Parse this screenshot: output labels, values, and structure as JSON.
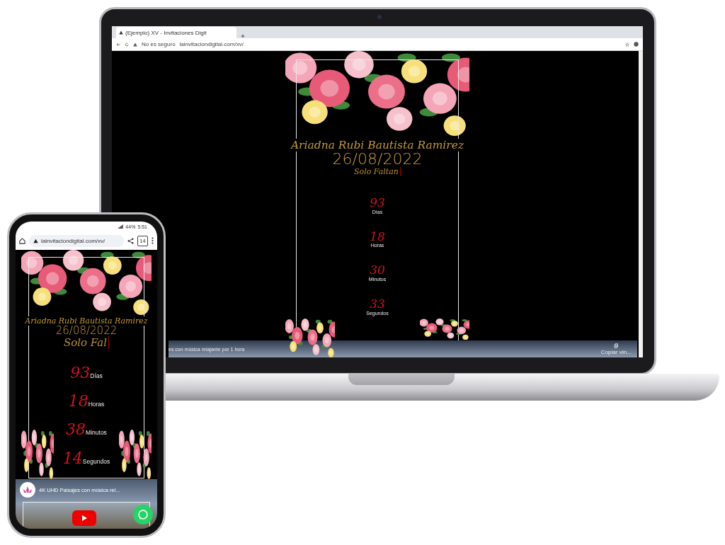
{
  "laptop": {
    "browser": {
      "tab_title": "(Ejemplo) XV - Invitaciones Digit",
      "security": "No es seguro",
      "url": "lainvitaciondigital.com/xv/"
    },
    "invitation": {
      "name": "Ariadna Rubi Bautista Ramirez",
      "date": "26/08/2022",
      "subtitle": "Solo Faltan",
      "countdown": [
        {
          "value": "93",
          "unit": "Días"
        },
        {
          "value": "18",
          "unit": "Horas"
        },
        {
          "value": "30",
          "unit": "Minutos"
        },
        {
          "value": "33",
          "unit": "Segundos"
        }
      ]
    },
    "video_bar": {
      "title": "es con música relajante por 1 hora",
      "action": "Copiar vín..."
    }
  },
  "phone": {
    "status": {
      "battery": "44%",
      "time": "5:51"
    },
    "url": "lainvitaciondigital.com/xv/",
    "tab_count": "14",
    "invitation": {
      "name": "Ariadna Rubi Bautista Ramirez",
      "date": "26/08/2022",
      "subtitle": "Solo Fal",
      "countdown": [
        {
          "value": "93",
          "unit": "Días"
        },
        {
          "value": "18",
          "unit": "Horas"
        },
        {
          "value": "38",
          "unit": "Minutos"
        },
        {
          "value": "14",
          "unit": "Segundos"
        }
      ]
    },
    "video": {
      "title": "4K UHD Paisajes con música rel..."
    }
  }
}
